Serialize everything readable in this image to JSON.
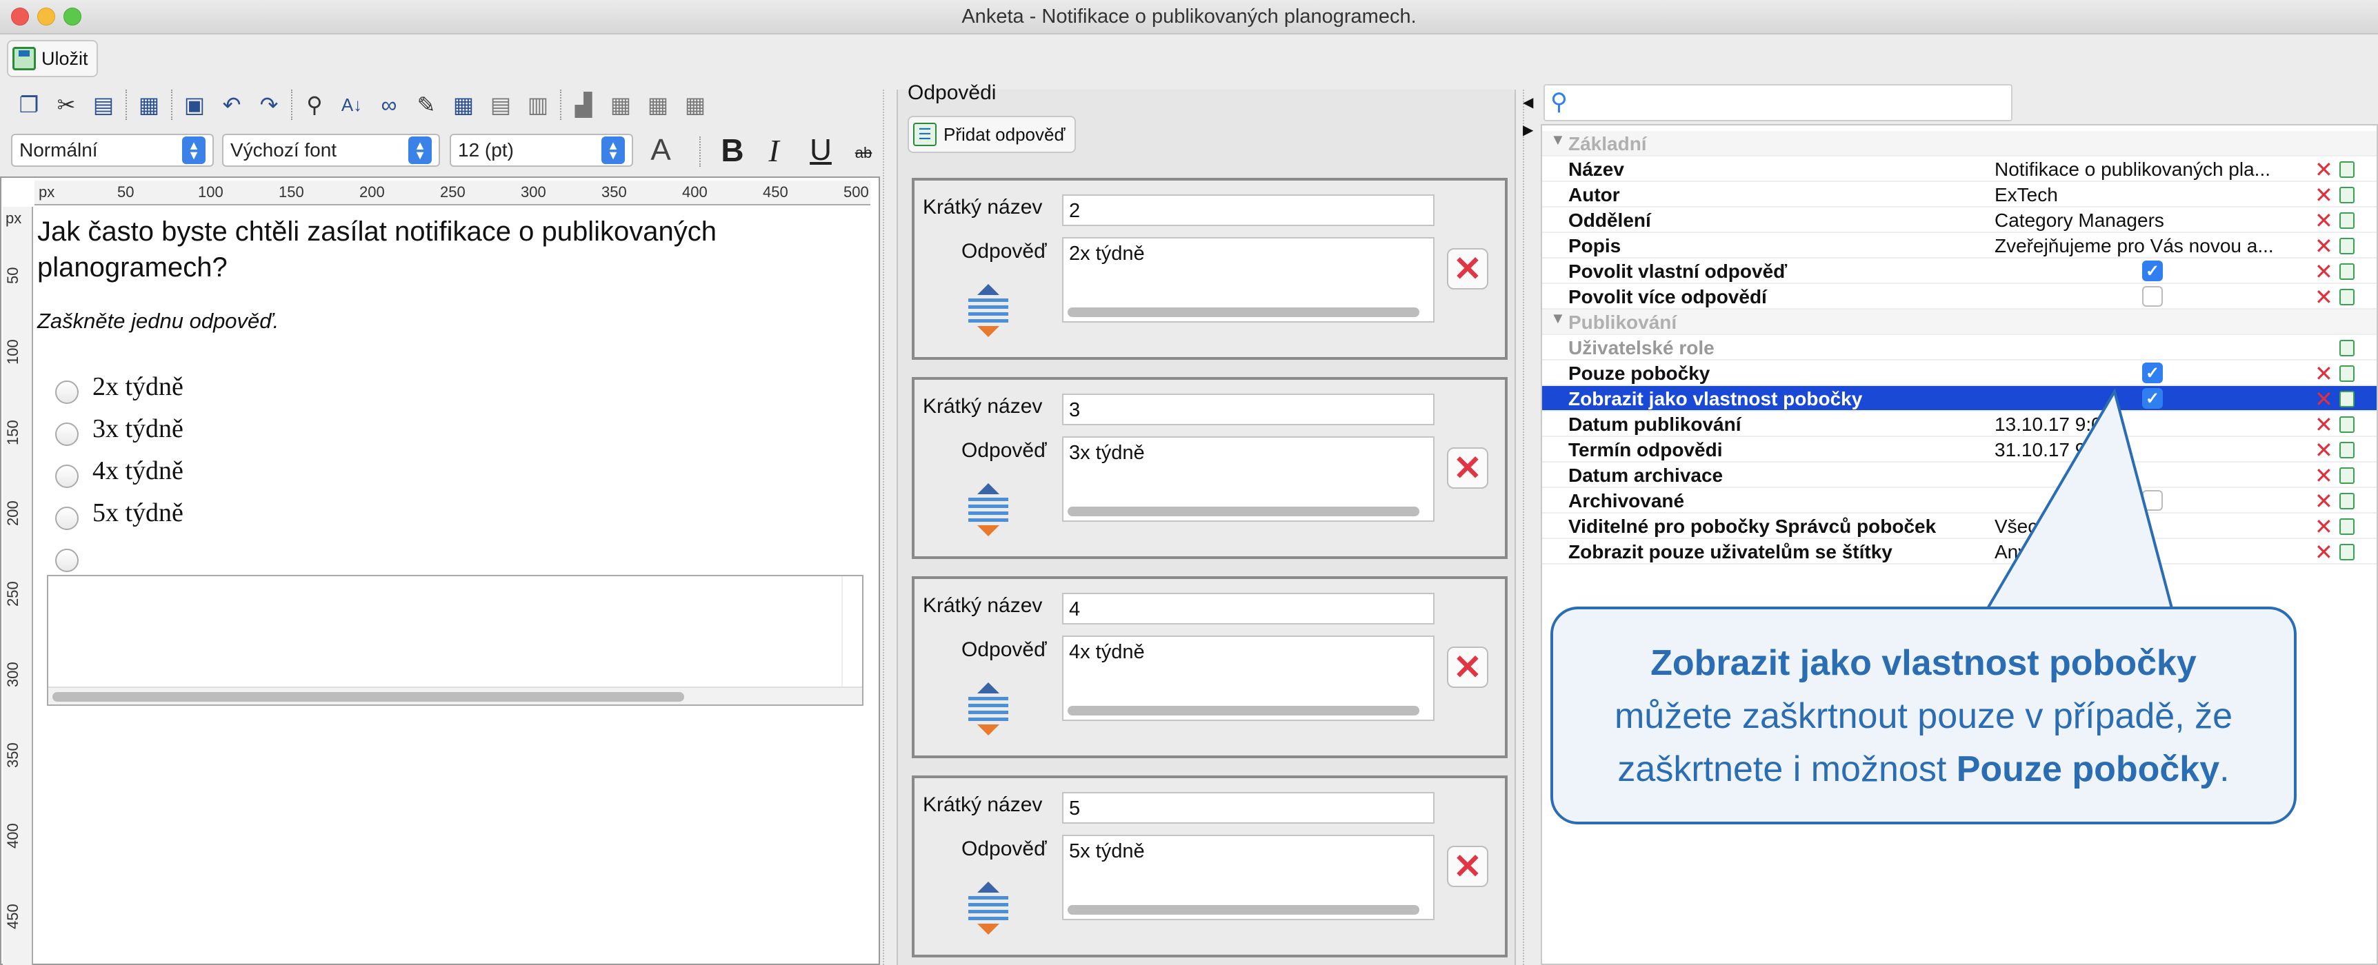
{
  "window": {
    "title": "Anketa - Notifikace o publikovaných planogramech."
  },
  "toolbar": {
    "save_label": "Uložit",
    "paragraph_style": "Normální",
    "font_family": "Výchozí font",
    "font_size": "12 (pt)"
  },
  "editor": {
    "ruler_unit": "px",
    "ruler_top_ticks": [
      "50",
      "100",
      "150",
      "200",
      "250",
      "300",
      "350",
      "400",
      "450",
      "500"
    ],
    "ruler_left_ticks": [
      "50",
      "100",
      "150",
      "200",
      "250",
      "300",
      "350",
      "400",
      "450"
    ],
    "question": "Jak často byste chtěli zasílat notifikace o publikovaných planogramech?",
    "hint": "Zaškněte jednu odpověď.",
    "options": [
      "2x týdně",
      "3x týdně",
      "4x týdně",
      "5x týdně"
    ]
  },
  "answers_panel": {
    "title": "Odpovědi",
    "add_label": "Přidat odpověď",
    "short_name_label": "Krátký název",
    "answer_label": "Odpověď",
    "answers": [
      {
        "short_name": "2",
        "text": "2x týdně"
      },
      {
        "short_name": "3",
        "text": "3x týdně"
      },
      {
        "short_name": "4",
        "text": "4x týdně"
      },
      {
        "short_name": "5",
        "text": "5x týdně"
      }
    ]
  },
  "properties": {
    "groups": [
      {
        "label": "Základní"
      },
      {
        "label": "Publikování"
      }
    ],
    "rows": [
      {
        "name": "Název",
        "value": "Notifikace o publikovaných pla..."
      },
      {
        "name": "Autor",
        "value": "ExTech"
      },
      {
        "name": "Oddělení",
        "value": "Category Managers"
      },
      {
        "name": "Popis",
        "value": "Zveřejňujeme pro Vás novou a..."
      },
      {
        "name": "Povolit vlastní odpověď",
        "checked": true
      },
      {
        "name": "Povolit více odpovědí",
        "checked": false
      },
      {
        "name": "Uživatelské role",
        "value": ""
      },
      {
        "name": "Pouze pobočky",
        "checked": true
      },
      {
        "name": "Zobrazit jako vlastnost pobočky",
        "checked": true
      },
      {
        "name": "Datum publikování",
        "value": "13.10.17 9:00"
      },
      {
        "name": "Termín odpovědi",
        "value": "31.10.17 9:00"
      },
      {
        "name": "Datum archivace",
        "value": ""
      },
      {
        "name": "Archivované",
        "checked": false
      },
      {
        "name": "Viditelné pro pobočky Správců poboček",
        "value": "Všechny pobočky"
      },
      {
        "name": "Zobrazit pouze uživatelům se štítky",
        "value": "Any"
      }
    ]
  },
  "callout": {
    "bold1": "Zobrazit jako vlastnost pobočky",
    "text1": "můžete zaškrtnout pouze v případě, že",
    "text2": "zaškrtnete i možnost",
    "bold2": "Pouze pobočky",
    "end": "."
  },
  "colors": {
    "accent": "#2a6db3",
    "selection": "#1a49d6",
    "delete": "#e03545"
  }
}
